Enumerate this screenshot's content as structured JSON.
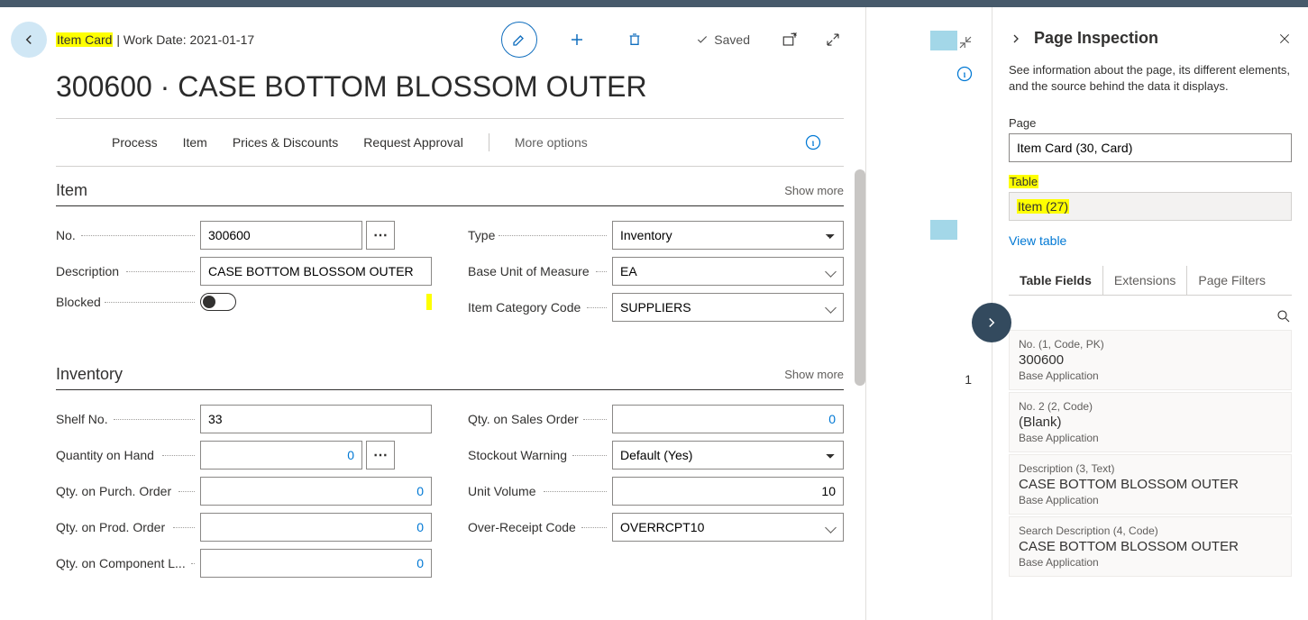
{
  "header": {
    "page_crumb": "Item Card",
    "work_date_label": "Work Date: 2021-01-17",
    "saved_label": "Saved",
    "page_title": "300600 · CASE BOTTOM BLOSSOM OUTER"
  },
  "actions": {
    "process": "Process",
    "item": "Item",
    "prices": "Prices & Discounts",
    "request": "Request Approval",
    "more": "More options"
  },
  "sections": {
    "item": {
      "title": "Item",
      "showmore": "Show more",
      "no_label": "No.",
      "no_value": "300600",
      "desc_label": "Description",
      "desc_value": "CASE BOTTOM BLOSSOM OUTER",
      "blocked_label": "Blocked",
      "type_label": "Type",
      "type_value": "Inventory",
      "uom_label": "Base Unit of Measure",
      "uom_value": "EA",
      "cat_label": "Item Category Code",
      "cat_value": "SUPPLIERS"
    },
    "inventory": {
      "title": "Inventory",
      "showmore": "Show more",
      "shelf_label": "Shelf No.",
      "shelf_value": "33",
      "qoh_label": "Quantity on Hand",
      "qoh_value": "0",
      "qpo_label": "Qty. on Purch. Order",
      "qpo_value": "0",
      "qprod_label": "Qty. on Prod. Order",
      "qprod_value": "0",
      "qcomp_label": "Qty. on Component L...",
      "qcomp_value": "0",
      "qso_label": "Qty. on Sales Order",
      "qso_value": "0",
      "stockout_label": "Stockout Warning",
      "stockout_value": "Default (Yes)",
      "uvol_label": "Unit Volume",
      "uvol_value": "10",
      "overrcpt_label": "Over-Receipt Code",
      "overrcpt_value": "OVERRCPT10"
    }
  },
  "mid": {
    "num": "1"
  },
  "inspector": {
    "title": "Page Inspection",
    "desc": "See information about the page, its different elements, and the source behind the data it displays.",
    "page_label": "Page",
    "page_value": "Item Card (30, Card)",
    "table_label": "Table",
    "table_value": "Item (27)",
    "view_table": "View table",
    "tab_fields": "Table Fields",
    "tab_ext": "Extensions",
    "tab_filters": "Page Filters",
    "fields": [
      {
        "name": "No. (1, Code, PK)",
        "value": "300600",
        "src": "Base Application"
      },
      {
        "name": "No. 2 (2, Code)",
        "value": "(Blank)",
        "src": "Base Application"
      },
      {
        "name": "Description (3, Text)",
        "value": "CASE BOTTOM BLOSSOM OUTER",
        "src": "Base Application"
      },
      {
        "name": "Search Description (4, Code)",
        "value": "CASE BOTTOM BLOSSOM OUTER",
        "src": "Base Application"
      }
    ]
  }
}
